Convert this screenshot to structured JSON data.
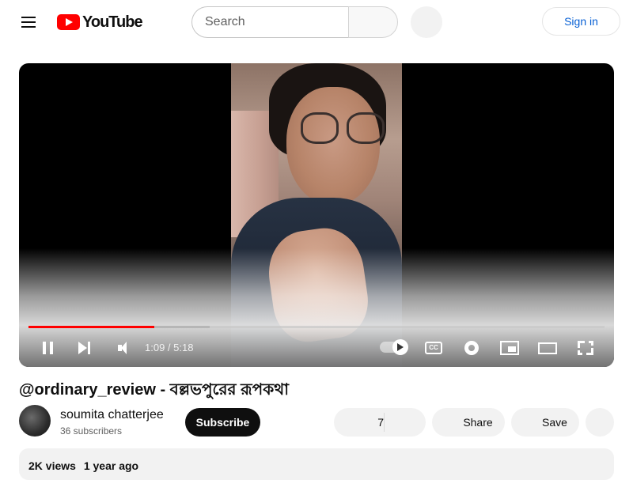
{
  "header": {
    "logo_text": "YouTube",
    "search_placeholder": "Search",
    "signin_label": "Sign in"
  },
  "player": {
    "current_time": "1:09",
    "duration": "5:18",
    "time_display": "1:09 / 5:18",
    "played_fraction": 0.218,
    "loaded_fraction": 0.315,
    "cc_label": "CC"
  },
  "video": {
    "title": "@ordinary_review - বল্লভপুরের রূপকথা",
    "channel_name": "soumita chatterjee",
    "subscribers": "36 subscribers",
    "subscribe_label": "Subscribe",
    "like_count": "7",
    "share_label": "Share",
    "save_label": "Save",
    "views": "2K views",
    "uploaded": "1 year ago"
  },
  "colors": {
    "accent": "#ff0000",
    "link": "#065fd4",
    "subscribe_bg": "#0f0f0f",
    "chip_bg": "#f2f2f2"
  }
}
